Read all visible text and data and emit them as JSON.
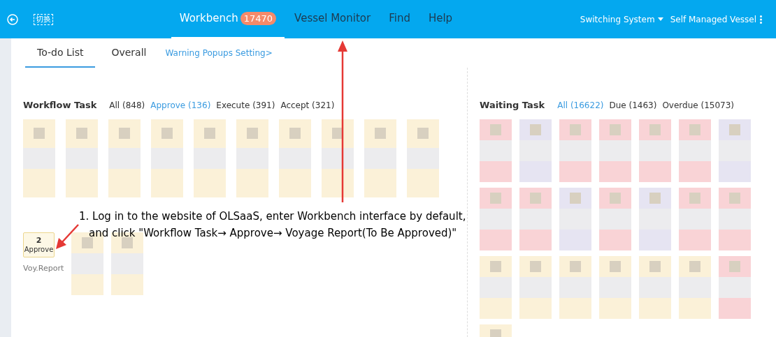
{
  "header": {
    "logo_text": "切换",
    "nav": [
      {
        "label": "Workbench",
        "badge": "17470",
        "selected": true
      },
      {
        "label": "Vessel Monitor",
        "selected": false
      },
      {
        "label": "Find",
        "selected": false
      },
      {
        "label": "Help",
        "selected": false
      }
    ],
    "system_menu": "Switching System",
    "vessel_menu": "Self Managed Vessel"
  },
  "subtabs": [
    {
      "label": "To-do List",
      "selected": true
    },
    {
      "label": "Overall",
      "selected": false
    }
  ],
  "settings_link": "Warning Popups Setting>",
  "workflow_task": {
    "title": "Workflow Task",
    "filters": [
      {
        "label": "All (848)",
        "selected": false
      },
      {
        "label": "Approve (136)",
        "selected": true
      },
      {
        "label": "Execute (391)",
        "selected": false
      },
      {
        "label": "Accept (321)",
        "selected": false
      }
    ],
    "blurred_rows": [
      [
        {
          "color": "#fbf1d8"
        },
        {
          "color": "#fbf1d8"
        },
        {
          "color": "#fbf1d8"
        },
        {
          "color": "#fbf1d8"
        },
        {
          "color": "#fbf1d8"
        },
        {
          "color": "#fbf1d8"
        },
        {
          "color": "#fbf1d8"
        },
        {
          "color": "#fbf1d8"
        },
        {
          "color": "#fbf1d8"
        },
        {
          "color": "#fbf1d8"
        }
      ]
    ],
    "item": {
      "count": "2",
      "action": "Approve",
      "label": "Voy.Report"
    },
    "blurred_after_item": [
      {
        "color": "#fbf1d8"
      },
      {
        "color": "#fbf1d8"
      }
    ]
  },
  "waiting_task": {
    "title": "Waiting Task",
    "filters": [
      {
        "label": "All (16622)",
        "selected": true
      },
      {
        "label": "Due (1463)",
        "selected": false
      },
      {
        "label": "Overdue (15073)",
        "selected": false
      }
    ],
    "blurred_rows": [
      [
        {
          "color": "#f9d3d6"
        },
        {
          "color": "#e6e4f2"
        },
        {
          "color": "#f9d3d6"
        },
        {
          "color": "#f9d3d6"
        },
        {
          "color": "#f9d3d6"
        },
        {
          "color": "#f9d3d6"
        },
        {
          "color": "#e6e4f2"
        }
      ],
      [
        {
          "color": "#f9d3d6"
        },
        {
          "color": "#f9d3d6"
        },
        {
          "color": "#e6e4f2"
        },
        {
          "color": "#f9d3d6"
        },
        {
          "color": "#e6e4f2"
        },
        {
          "color": "#f9d3d6"
        },
        {
          "color": "#f9d3d6"
        }
      ],
      [
        {
          "color": "#fbf1d8"
        },
        {
          "color": "#fbf1d8"
        },
        {
          "color": "#fbf1d8"
        },
        {
          "color": "#fbf1d8"
        },
        {
          "color": "#fbf1d8"
        },
        {
          "color": "#fbf1d8"
        },
        {
          "color": "#f9d3d6"
        }
      ],
      [
        {
          "color": "#fbf1d8"
        }
      ]
    ]
  },
  "annotation": {
    "lines": [
      "1. Log in to the website of OLSaaS, enter Workbench interface by default,",
      "and click \"Workflow Task→ Approve→ Voyage Report(To Be Approved)\""
    ]
  }
}
